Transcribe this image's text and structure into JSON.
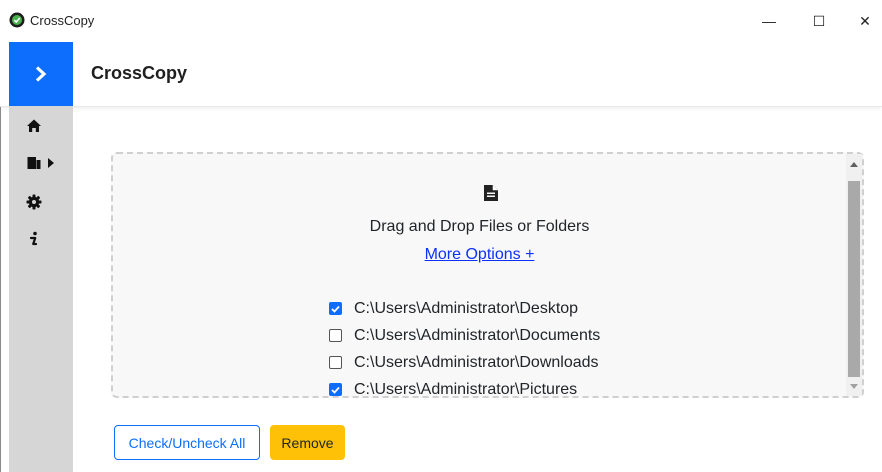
{
  "window": {
    "title": "CrossCopy",
    "minimize_glyph": "—",
    "maximize_glyph": "☐",
    "close_glyph": "✕"
  },
  "header": {
    "title": "CrossCopy",
    "menu_icon": "chevron-right-icon",
    "accent_color": "#0d6efd"
  },
  "sidebar": {
    "items": [
      {
        "name": "home",
        "icon": "home-icon"
      },
      {
        "name": "bookmarks",
        "icon": "bookmark-icon",
        "has_submenu": true
      },
      {
        "name": "settings",
        "icon": "gear-icon"
      },
      {
        "name": "info",
        "icon": "info-icon"
      }
    ]
  },
  "dropzone": {
    "icon": "file-icon",
    "text": "Drag and Drop Files or Folders",
    "more_options": "More Options +"
  },
  "paths": [
    {
      "path": "C:\\Users\\Administrator\\Desktop",
      "checked": true
    },
    {
      "path": "C:\\Users\\Administrator\\Documents",
      "checked": false
    },
    {
      "path": "C:\\Users\\Administrator\\Downloads",
      "checked": false
    },
    {
      "path": "C:\\Users\\Administrator\\Pictures",
      "checked": true
    }
  ],
  "buttons": {
    "check_all": "Check/Uncheck All",
    "remove": "Remove"
  },
  "colors": {
    "primary": "#0d6efd",
    "warning": "#ffc107",
    "sidebar_bg": "#d6d6d6",
    "link": "#0d30ff"
  }
}
